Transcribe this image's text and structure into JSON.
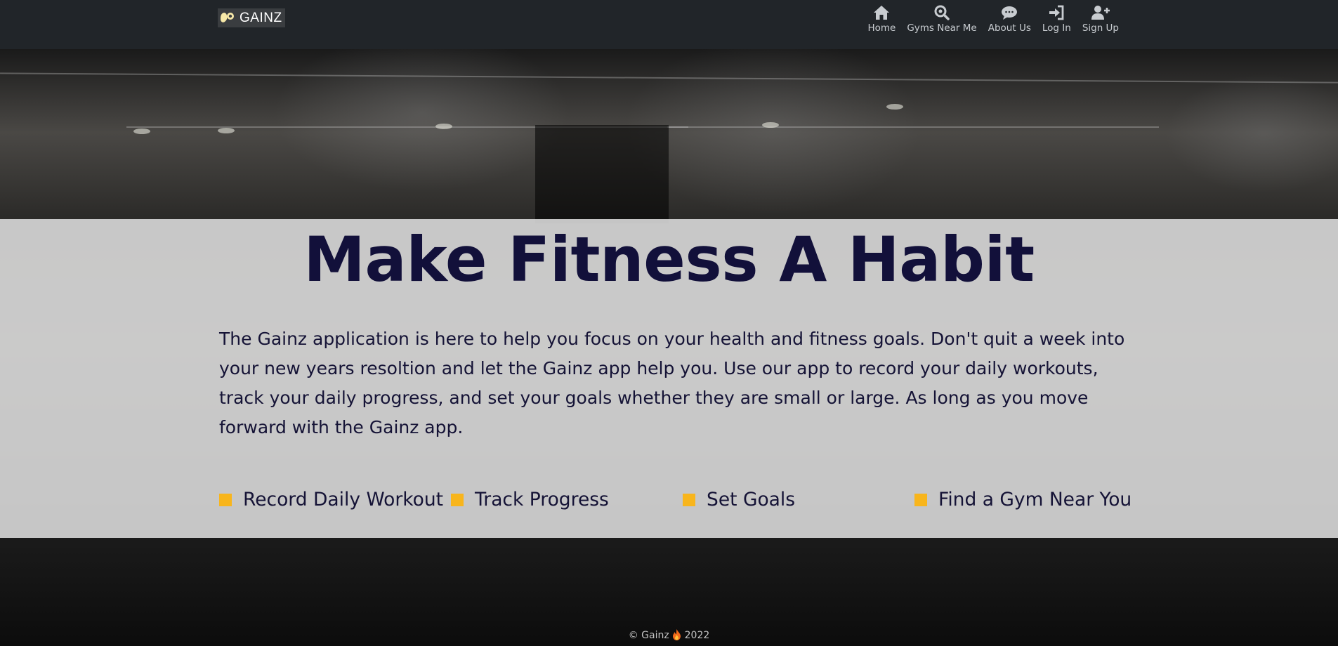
{
  "brand": {
    "name": "GAINZ",
    "icon": "flexing-arm-icon"
  },
  "nav": {
    "items": [
      {
        "label": "Home",
        "icon": "home-icon"
      },
      {
        "label": "Gyms Near Me",
        "icon": "search-location-icon"
      },
      {
        "label": "About Us",
        "icon": "chat-bubble-icon"
      },
      {
        "label": "Log In",
        "icon": "login-icon"
      },
      {
        "label": "Sign Up",
        "icon": "user-plus-icon"
      }
    ]
  },
  "hero": {
    "title": "Make Fitness A Habit",
    "intro": "The Gainz application is here to help you focus on your health and fitness goals. Don't quit a week into your new years resoltion and let the Gainz app help you. Use our app to record your daily workouts, track your daily progress, and set your goals whether they are small or large. As long as you move forward with the Gainz app.",
    "features": [
      "Record Daily Workout",
      "Track Progress",
      "Set Goals",
      "Find a Gym Near You"
    ]
  },
  "footer": {
    "copyright_prefix": "© Gainz",
    "year": "2022"
  },
  "colors": {
    "navbar": "#212529",
    "headline": "#12103a",
    "bullet": "#f8b51c",
    "panel": "#dedede"
  }
}
